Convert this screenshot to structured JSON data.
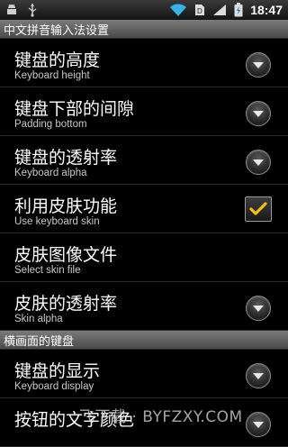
{
  "status_bar": {
    "time": "18:47",
    "icons": [
      "android-debug-icon",
      "usb-icon",
      "wifi-icon",
      "sd-card-icon",
      "signal-icon",
      "battery-charging-icon"
    ]
  },
  "title": "中文拼音输入法设置",
  "items": [
    {
      "title": "键盘的高度",
      "subtitle": "Keyboard height",
      "control": "dropdown"
    },
    {
      "title": "键盘下部的间隙",
      "subtitle": "Padding bottom",
      "control": "dropdown"
    },
    {
      "title": "键盘的透射率",
      "subtitle": "Keyboard alpha",
      "control": "dropdown"
    },
    {
      "title": "利用皮肤功能",
      "subtitle": "Use keyboard skin",
      "control": "checkbox",
      "checked": true
    },
    {
      "title": "皮肤图像文件",
      "subtitle": "Select skin file",
      "control": "none"
    },
    {
      "title": "皮肤的透射率",
      "subtitle": "Skin alpha",
      "control": "dropdown"
    }
  ],
  "section": "横画面的键盘",
  "section_items": [
    {
      "title": "键盘的显示",
      "subtitle": "Keyboard display",
      "control": "dropdown"
    },
    {
      "title": "按钮的文字颜色",
      "subtitle": "",
      "control": "dropdown"
    }
  ],
  "watermark": "飞下载 · BYFZXY.COM",
  "colors": {
    "checkmark": "#f5c400",
    "background": "#000000",
    "header": "#5f5f5f"
  }
}
